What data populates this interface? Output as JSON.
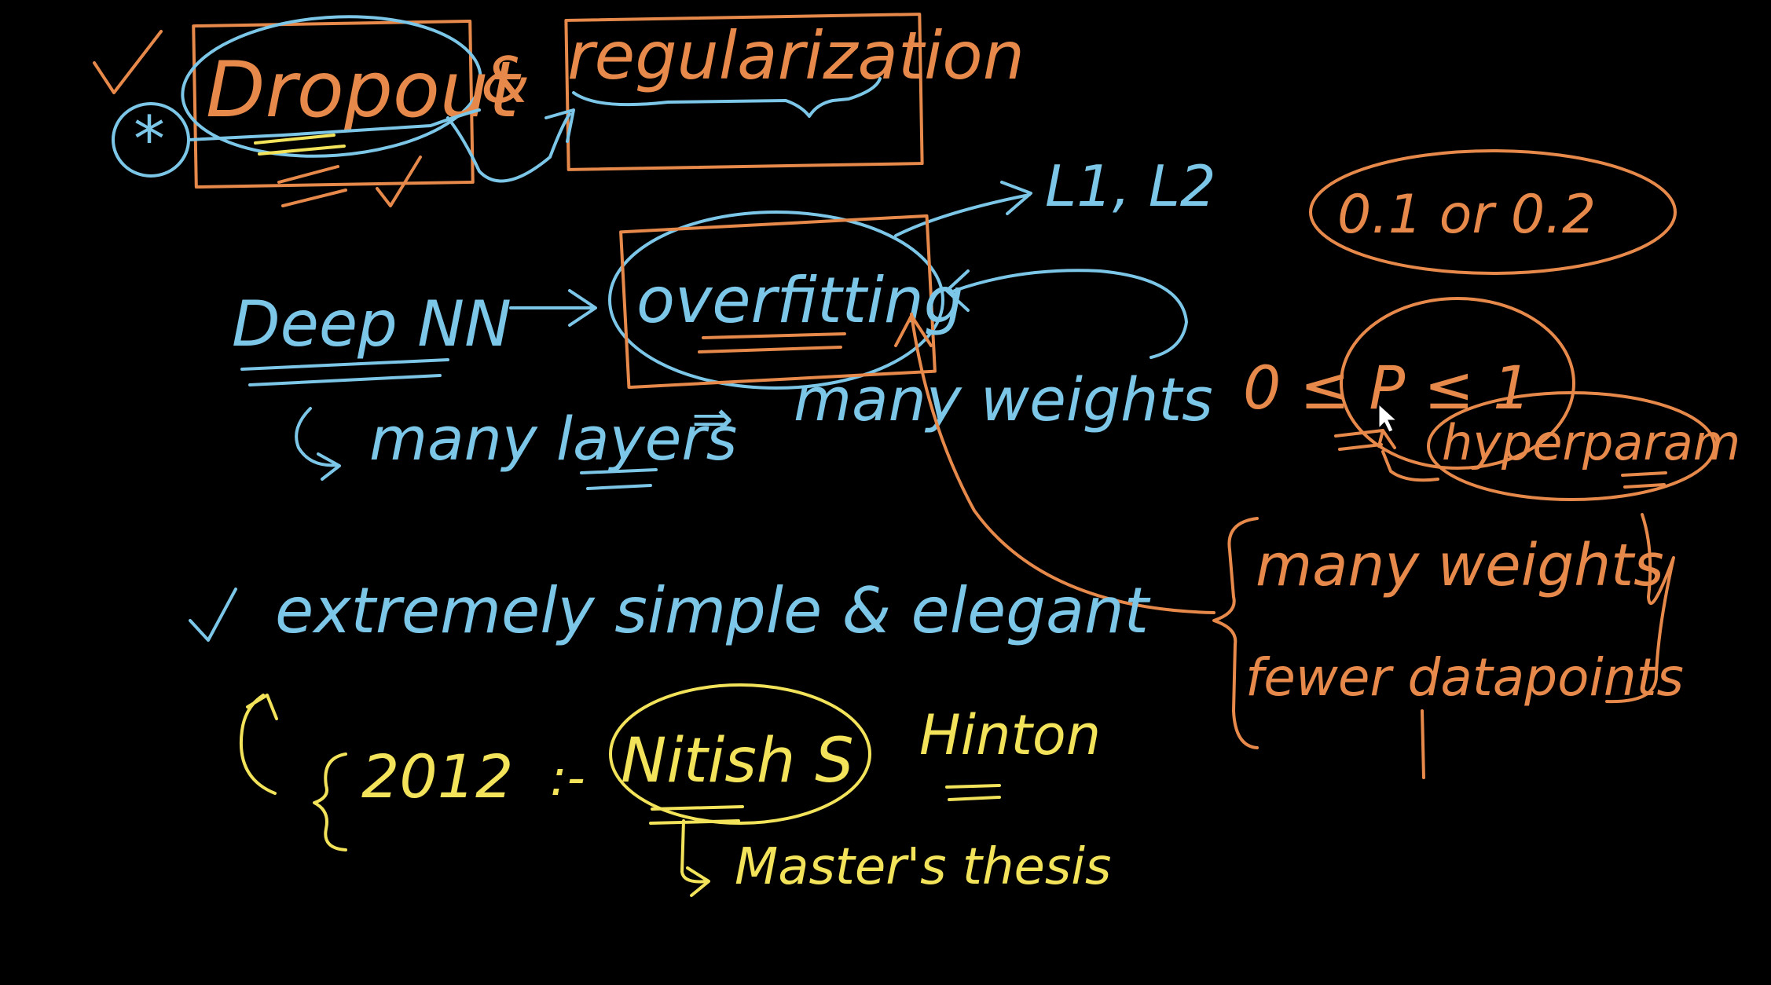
{
  "colors": {
    "background": "#000000",
    "blue": "#7cc6e8",
    "orange": "#e6894a",
    "yellow": "#f2e35a"
  },
  "title": {
    "dropout": "Dropout",
    "and": "&",
    "regularization": "regularization",
    "star": "*",
    "check": "✓"
  },
  "links": {
    "l1l2": "L1, L2"
  },
  "flow": {
    "deep_nn": "Deep NN",
    "overfitting": "overfitting",
    "many_layers": "many layers",
    "implies": "⇒",
    "many_weights": "many weights"
  },
  "notes": {
    "range": "0.1 or 0.2",
    "p_bound": "0 ≤ P ≤ 1",
    "hyperparam": "hyperparam",
    "many_weights": "many weights",
    "fewer_datapoints": "fewer datapoints"
  },
  "simple": {
    "check": "✓",
    "text": "extremely simple & elegant"
  },
  "history": {
    "year": "2012",
    "sep": ":-",
    "author": "Nitish S",
    "coauthor": "Hinton",
    "thesis": "Master's thesis"
  },
  "cursor_icon": "mouse-pointer-icon"
}
